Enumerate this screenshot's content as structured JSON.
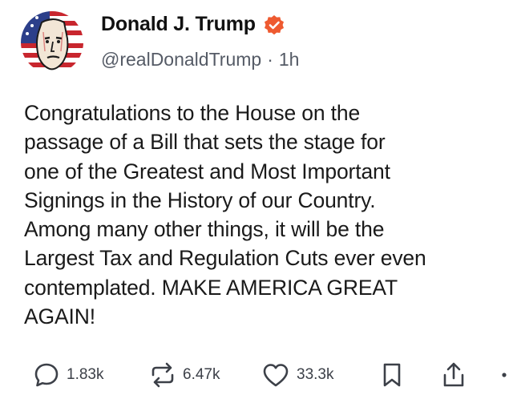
{
  "author": {
    "display_name": "Donald J. Trump",
    "handle": "@realDonaldTrump",
    "separator": "·",
    "timestamp": "1h",
    "verified_icon": "verified-badge-icon",
    "avatar_icon": "avatar-portrait-flag"
  },
  "post": {
    "text": "Congratulations to the House on the\npassage of a Bill that sets the stage for\none of the Greatest and Most Important\nSignings in the History of our Country.\nAmong many other things, it will be the\nLargest Tax and Regulation Cuts ever even\ncontemplated. MAKE AMERICA GREAT\nAGAIN!"
  },
  "actions": {
    "reply_count": "1.83k",
    "repost_count": "6.47k",
    "like_count": "33.3k",
    "icons": [
      "reply-icon",
      "repost-icon",
      "like-icon",
      "bookmark-icon",
      "share-icon",
      "more-icon"
    ]
  },
  "colors": {
    "verified": "#ee5a30",
    "text": "#1a1a1a",
    "muted": "#555b66",
    "icon": "#3c4048"
  }
}
